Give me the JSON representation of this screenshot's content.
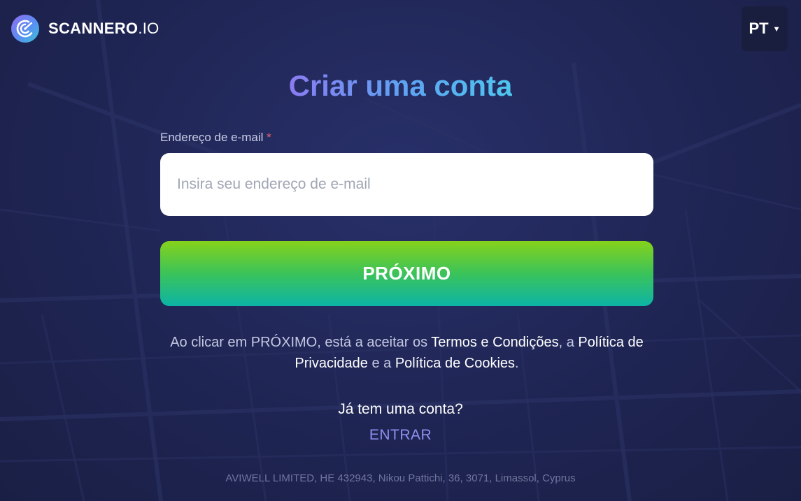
{
  "brand": {
    "name": "SCANNERO",
    "suffix": ".IO",
    "logo_icon": "scannero-radar-icon"
  },
  "language": {
    "selected": "PT",
    "caret": "▼"
  },
  "page": {
    "title": "Criar uma conta"
  },
  "form": {
    "email_label": "Endereço de e-mail",
    "required_mark": "*",
    "email_value": "",
    "email_placeholder": "Insira seu endereço de e-mail",
    "next_label": "PRÓXIMO"
  },
  "terms": {
    "prefix": "Ao clicar em PRÓXIMO, está a aceitar os ",
    "terms_link": "Termos e Condições",
    "separator": ", a ",
    "privacy_link": "Política de Privacidade",
    "and": " e a ",
    "cookies_link": "Política de Cookies",
    "suffix": "."
  },
  "login": {
    "question": "Já tem uma conta?",
    "link_label": "ENTRAR"
  },
  "footer": {
    "text": "AVIWELL LIMITED, HE 432943, Nikou Pattichi, 36, 3071, Limassol, Cyprus"
  },
  "colors": {
    "background": "#1f2550",
    "title_gradient_start": "#8a7cf1",
    "title_gradient_end": "#4ec6ee",
    "button_gradient_top": "#86d21a",
    "button_gradient_bottom": "#0db4a6",
    "login_link": "#8e8ff0",
    "required": "#e26466"
  }
}
